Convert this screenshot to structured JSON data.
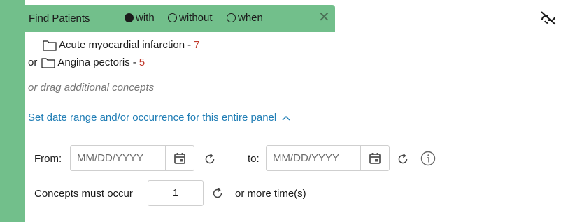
{
  "panel": {
    "title": "Find Patients",
    "mode_options": [
      {
        "label": "with",
        "selected": true
      },
      {
        "label": "without",
        "selected": false
      },
      {
        "label": "when",
        "selected": false
      }
    ],
    "close_icon": "close-icon",
    "unlink_icon": "unlink-icon",
    "accent_color": "#72bf8b"
  },
  "concepts": [
    {
      "prefix": "",
      "name": "Acute myocardial infarction",
      "count": "7"
    },
    {
      "prefix": "or",
      "name": "Angina pectoris",
      "count": "5"
    }
  ],
  "drag_hint": "or drag additional concepts",
  "date_range_link": "Set date range and/or occurrence for this entire panel",
  "date_range": {
    "from_label": "From:",
    "from_placeholder": "MM/DD/YYYY",
    "to_label": "to:",
    "to_placeholder": "MM/DD/YYYY"
  },
  "occurrence": {
    "label": "Concepts must occur",
    "value": "1",
    "suffix": "or more time(s)"
  },
  "colors": {
    "count": "#c0392b",
    "link": "#1f7db5"
  }
}
